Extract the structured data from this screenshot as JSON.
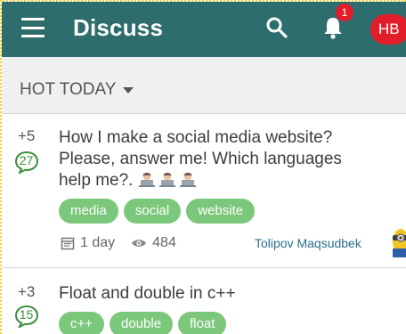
{
  "appbar": {
    "title": "Discuss",
    "menu_icon": "hamburger-menu-icon",
    "search_icon": "search-icon",
    "notifications_icon": "bell-icon",
    "notification_count": "1",
    "avatar_initials": "HB",
    "bar_color": "#2e6d6d",
    "accent_color": "#e11d2a"
  },
  "filter": {
    "label": "HOT TODAY",
    "icon": "caret-down-icon"
  },
  "posts": [
    {
      "votes": "+5",
      "answers": "27",
      "title_line1": "How I make a social media website?",
      "title_line2": "Please, answer me! Which languages",
      "title_line3": "help me?.",
      "title_emoji": "man-technologist-emoji",
      "tags": [
        "media",
        "social",
        "website"
      ],
      "age": "1 day",
      "views": "484",
      "author": "Tolipov Maqsudbek",
      "age_icon": "calendar-icon",
      "views_icon": "eye-icon"
    },
    {
      "votes": "+3",
      "answers": "15",
      "title": "Float and double in c++",
      "tags": [
        "c++",
        "double",
        "float"
      ]
    }
  ],
  "colors": {
    "tag": "#7bc77b",
    "answer": "#3b8e3b",
    "author": "#2a6f8a"
  }
}
